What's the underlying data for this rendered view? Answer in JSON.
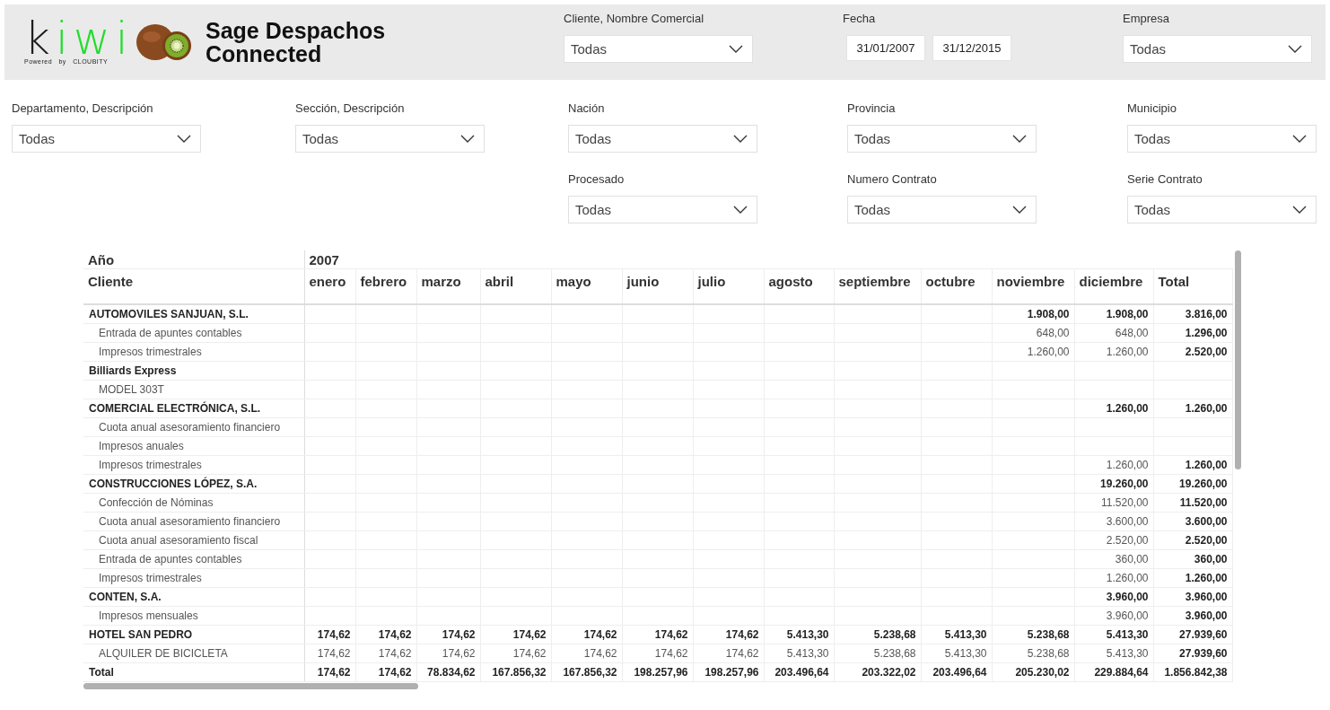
{
  "header": {
    "logo": {
      "parts": [
        {
          "text": "k",
          "color": "#1e1e1e"
        },
        {
          "text": "iwi",
          "color": "#22dd2c"
        }
      ],
      "tagline": "Powered   by   CLOUBITY"
    },
    "title": "Sage Despachos Connected",
    "filters": [
      {
        "kind": "dropdown",
        "label": "Cliente, Nombre Comercial",
        "value": "Todas"
      },
      {
        "kind": "dates",
        "label": "Fecha",
        "from": "31/01/2007",
        "to": "31/12/2015"
      },
      {
        "kind": "dropdown",
        "label": "Empresa",
        "value": "Todas"
      }
    ]
  },
  "filter_rows": [
    [
      {
        "kind": "dropdown",
        "label": "Departamento, Descripción",
        "value": "Todas"
      },
      {
        "kind": "dropdown",
        "label": "Sección, Descripción",
        "value": "Todas"
      },
      {
        "kind": "dropdown",
        "label": "Nación",
        "value": "Todas"
      },
      {
        "kind": "dropdown",
        "label": "Provincia",
        "value": "Todas"
      },
      {
        "kind": "dropdown",
        "label": "Municipio",
        "value": "Todas"
      }
    ],
    [
      {
        "kind": "dropdown",
        "label": "Procesado",
        "value": "Todas"
      },
      {
        "kind": "dropdown",
        "label": "Numero Contrato",
        "value": "Todas"
      },
      {
        "kind": "dropdown",
        "label": "Serie Contrato",
        "value": "Todas"
      }
    ]
  ],
  "matrix": {
    "year_label": "Año",
    "year": "2007",
    "row_label": "Cliente",
    "columns": [
      "enero",
      "febrero",
      "marzo",
      "abril",
      "mayo",
      "junio",
      "julio",
      "agosto",
      "septiembre",
      "octubre",
      "noviembre",
      "diciembre",
      "Total"
    ],
    "rows": [
      {
        "kind": "group",
        "label": "AUTOMOVILES SANJUAN, S.L.",
        "cells": {
          "10": "1.908,00",
          "11": "1.908,00",
          "12": "3.816,00"
        }
      },
      {
        "kind": "item",
        "label": "Entrada de apuntes contables",
        "cells": {
          "10": "648,00",
          "11": "648,00",
          "12": "1.296,00"
        }
      },
      {
        "kind": "item",
        "label": "Impresos trimestrales",
        "cells": {
          "10": "1.260,00",
          "11": "1.260,00",
          "12": "2.520,00"
        }
      },
      {
        "kind": "group",
        "label": "Billiards Express"
      },
      {
        "kind": "item",
        "label": "MODEL 303T"
      },
      {
        "kind": "group",
        "label": "COMERCIAL ELECTRÓNICA, S.L.",
        "cells": {
          "11": "1.260,00",
          "12": "1.260,00"
        }
      },
      {
        "kind": "item",
        "label": "Cuota anual asesoramiento financiero"
      },
      {
        "kind": "item",
        "label": "Impresos anuales"
      },
      {
        "kind": "item",
        "label": "Impresos trimestrales",
        "cells": {
          "11": "1.260,00",
          "12": "1.260,00"
        }
      },
      {
        "kind": "group",
        "label": "CONSTRUCCIONES LÓPEZ, S.A.",
        "cells": {
          "11": "19.260,00",
          "12": "19.260,00"
        }
      },
      {
        "kind": "item",
        "label": "Confección de Nóminas",
        "cells": {
          "11": "11.520,00",
          "12": "11.520,00"
        }
      },
      {
        "kind": "item",
        "label": "Cuota anual asesoramiento financiero",
        "cells": {
          "11": "3.600,00",
          "12": "3.600,00"
        }
      },
      {
        "kind": "item",
        "label": "Cuota anual asesoramiento fiscal",
        "cells": {
          "11": "2.520,00",
          "12": "2.520,00"
        }
      },
      {
        "kind": "item",
        "label": "Entrada de apuntes contables",
        "cells": {
          "11": "360,00",
          "12": "360,00"
        }
      },
      {
        "kind": "item",
        "label": "Impresos trimestrales",
        "cells": {
          "11": "1.260,00",
          "12": "1.260,00"
        }
      },
      {
        "kind": "group",
        "label": "CONTEN, S.A.",
        "cells": {
          "11": "3.960,00",
          "12": "3.960,00"
        }
      },
      {
        "kind": "item",
        "label": "Impresos mensuales",
        "cells": {
          "11": "3.960,00",
          "12": "3.960,00"
        }
      },
      {
        "kind": "group",
        "label": "HOTEL SAN PEDRO",
        "cells": {
          "0": "174,62",
          "1": "174,62",
          "2": "174,62",
          "3": "174,62",
          "4": "174,62",
          "5": "174,62",
          "6": "174,62",
          "7": "5.413,30",
          "8": "5.238,68",
          "9": "5.413,30",
          "10": "5.238,68",
          "11": "5.413,30",
          "12": "27.939,60"
        }
      },
      {
        "kind": "item",
        "label": "ALQUILER DE BICICLETA",
        "cells": {
          "0": "174,62",
          "1": "174,62",
          "2": "174,62",
          "3": "174,62",
          "4": "174,62",
          "5": "174,62",
          "6": "174,62",
          "7": "5.413,30",
          "8": "5.238,68",
          "9": "5.413,30",
          "10": "5.238,68",
          "11": "5.413,30",
          "12": "27.939,60"
        }
      },
      {
        "kind": "total",
        "label": "Total",
        "cells": {
          "0": "174,62",
          "1": "174,62",
          "2": "78.834,62",
          "3": "167.856,32",
          "4": "167.856,32",
          "5": "198.257,96",
          "6": "198.257,96",
          "7": "203.496,64",
          "8": "203.322,02",
          "9": "203.496,64",
          "10": "205.230,02",
          "11": "229.884,64",
          "12": "1.856.842,38"
        }
      }
    ]
  }
}
